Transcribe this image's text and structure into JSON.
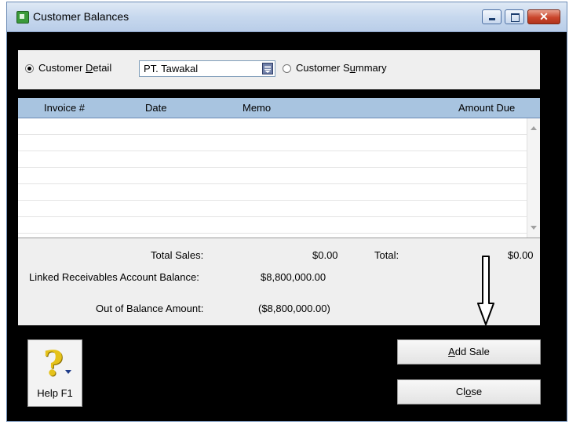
{
  "window": {
    "title": "Customer Balances"
  },
  "selector": {
    "detail_label_pre": "Customer ",
    "detail_label_key": "D",
    "detail_label_post": "etail",
    "detail_selected": true,
    "customer_value": "PT. Tawakal",
    "summary_label_pre": "Customer S",
    "summary_label_key": "u",
    "summary_label_post": "mmary",
    "summary_selected": false
  },
  "table": {
    "columns": [
      "Invoice #",
      "Date",
      "Memo",
      "Amount Due"
    ],
    "rows": []
  },
  "totals": {
    "total_sales_label": "Total Sales:",
    "total_sales_value": "$0.00",
    "total_label": "Total:",
    "total_value": "$0.00",
    "linked_label": "Linked Receivables Account Balance:",
    "linked_value": "$8,800,000.00",
    "out_of_balance_label": "Out of Balance Amount:",
    "out_of_balance_value": "($8,800,000.00)"
  },
  "buttons": {
    "help_label": "Help F1",
    "add_sale_key": "A",
    "add_sale_rest": "dd Sale",
    "close_pre": "Cl",
    "close_key": "o",
    "close_post": "se"
  },
  "colors": {
    "window_background": "#000000",
    "header_background": "#a8c4e0",
    "panel_background": "#efefef"
  },
  "icons": [
    "app-icon",
    "minimize-icon",
    "maximize-icon",
    "close-icon",
    "dropdown-list-icon",
    "help-question-icon",
    "down-arrow-annotation"
  ]
}
